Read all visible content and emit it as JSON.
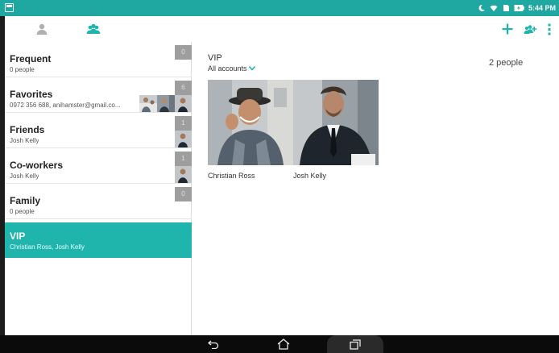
{
  "status_bar": {
    "time": "5:44 PM",
    "icons": [
      "moon-icon",
      "wifi-icon",
      "sim-icon",
      "battery-charging-icon"
    ]
  },
  "toolbar": {
    "tabs": [
      {
        "icon": "person-icon",
        "active": false
      },
      {
        "icon": "group-icon",
        "active": true
      }
    ],
    "actions": [
      "add-icon",
      "add-group-icon",
      "overflow-menu-icon"
    ]
  },
  "groups": [
    {
      "name": "Frequent",
      "subtitle": "0 people",
      "count": "0"
    },
    {
      "name": "Favorites",
      "subtitle": "0972 356 688, anihamster@gmail.co...",
      "count": "6"
    },
    {
      "name": "Friends",
      "subtitle": "Josh Kelly",
      "count": "1"
    },
    {
      "name": "Co-workers",
      "subtitle": "Josh Kelly",
      "count": "1"
    },
    {
      "name": "Family",
      "subtitle": "0 people",
      "count": "0"
    },
    {
      "name": "VIP",
      "subtitle": "Christian Ross, Josh Kelly",
      "selected": true
    }
  ],
  "detail": {
    "title": "VIP",
    "accounts_label": "All accounts",
    "people_count": "2 people",
    "members": [
      {
        "name": "Christian Ross"
      },
      {
        "name": "Josh Kelly"
      }
    ]
  },
  "colors": {
    "accent": "#1fb5ad",
    "status_bar": "#1fa7a1",
    "badge": "#9e9e9e"
  },
  "nav": [
    "back-icon",
    "home-icon",
    "recent-apps-icon"
  ]
}
